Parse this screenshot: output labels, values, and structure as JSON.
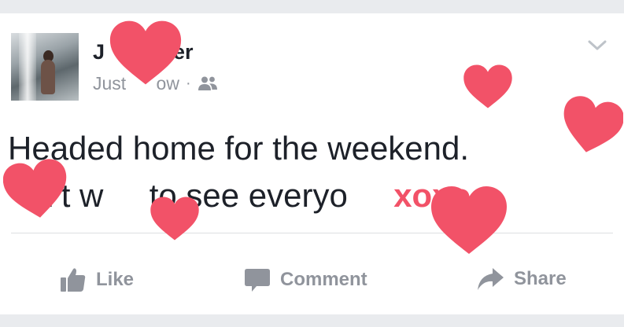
{
  "post": {
    "author_name": "J       arter",
    "timestamp": "Just      ow",
    "separator": "·",
    "audience_icon": "friends-icon",
    "text_line1": "Headed home for the weekend.",
    "text_line2": "   n’t w     to see everyo     ",
    "text_emphasis": "xoxo"
  },
  "actions": {
    "like_label": "Like",
    "comment_label": "Comment",
    "share_label": "Share"
  },
  "icons": [
    "chevron-down-icon",
    "like-icon",
    "comment-icon",
    "share-icon",
    "heart-icon"
  ],
  "colors": {
    "heart": "#f25268",
    "text": "#1d2129",
    "secondary_text": "#90949c",
    "background": "#e9ebee"
  }
}
